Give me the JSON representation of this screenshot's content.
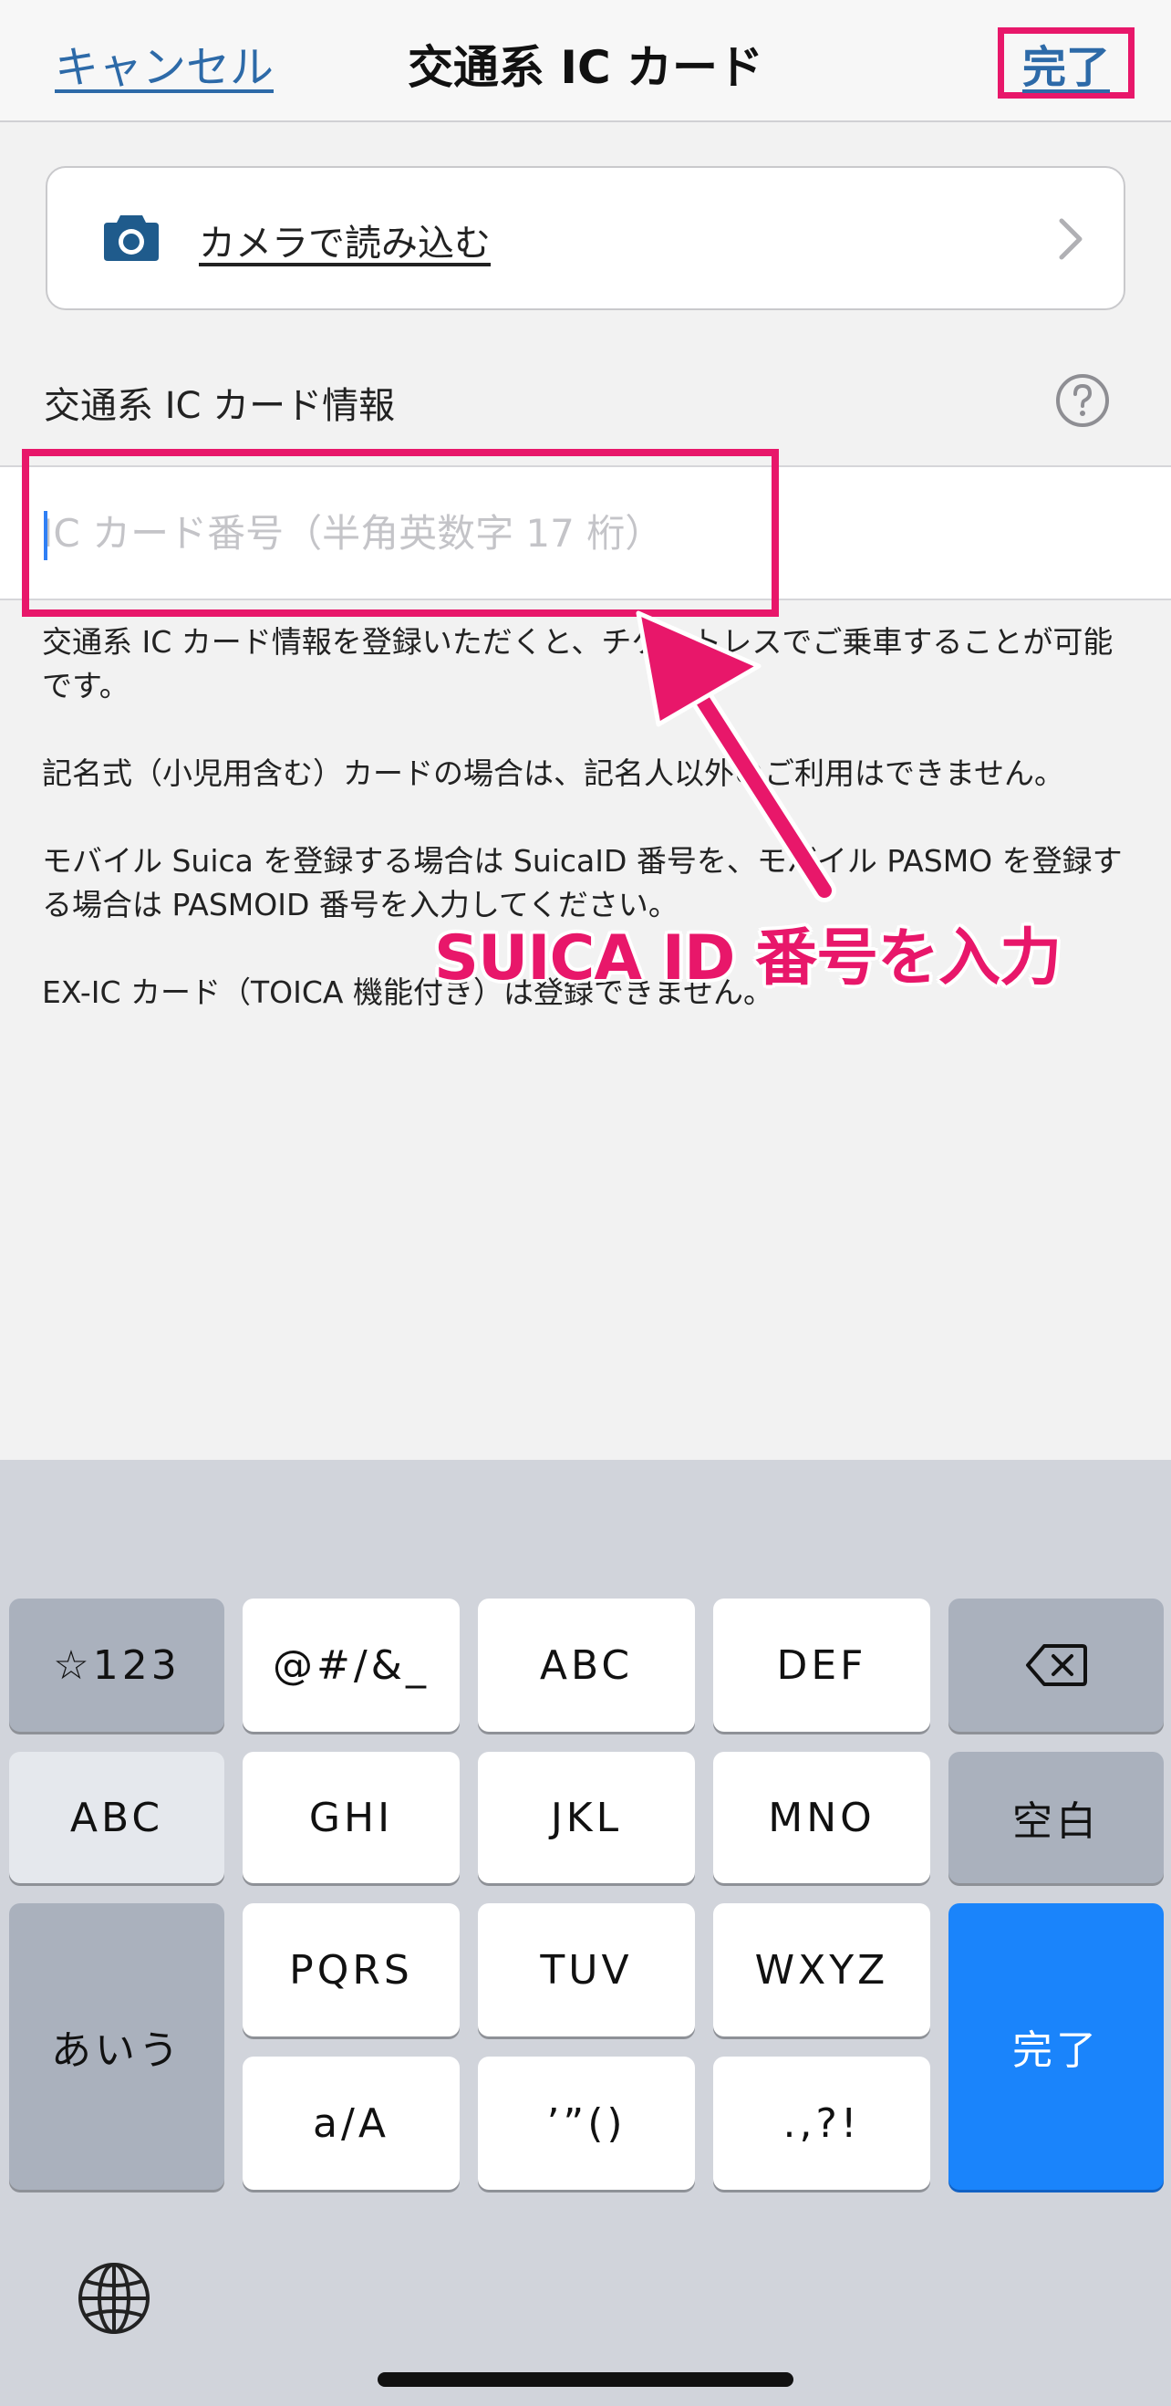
{
  "nav": {
    "cancel": "キャンセル",
    "title": "交通系 IC カード",
    "done": "完了"
  },
  "camera": {
    "label": "カメラで読み込む",
    "icon": "camera-icon"
  },
  "section": {
    "label": "交通系 IC カード情報",
    "help_icon": "question-circle-icon"
  },
  "input": {
    "placeholder": "IC カード番号（半角英数字 17 桁）",
    "value": ""
  },
  "notes": [
    "交通系 IC カード情報を登録いただくと、チケットレスでご乗車することが可能です。",
    "記名式（小児用含む）カードの場合は、記名人以外のご利用はできません。",
    "モバイル Suica を登録する場合は SuicaID 番号を、モバイル PASMO を登録する場合は PASMOID 番号を入力してください。",
    "EX-IC カード（TOICA 機能付き）は登録できません。"
  ],
  "annotation": {
    "callout": "SUICA ID 番号を入力",
    "color": "#e8176a"
  },
  "keyboard": {
    "row1": [
      "☆123",
      "@#/&_",
      "ABC",
      "DEF"
    ],
    "row2": [
      "ABC",
      "GHI",
      "JKL",
      "MNO",
      "空白"
    ],
    "row3": [
      "あいう",
      "PQRS",
      "TUV",
      "WXYZ",
      "完了"
    ],
    "row4": [
      "a/A",
      "’”()",
      ".,?!"
    ],
    "delete_icon": "backspace-icon",
    "globe_icon": "globe-icon"
  },
  "colors": {
    "link": "#2d6aa8",
    "return_key": "#1a84fb"
  }
}
